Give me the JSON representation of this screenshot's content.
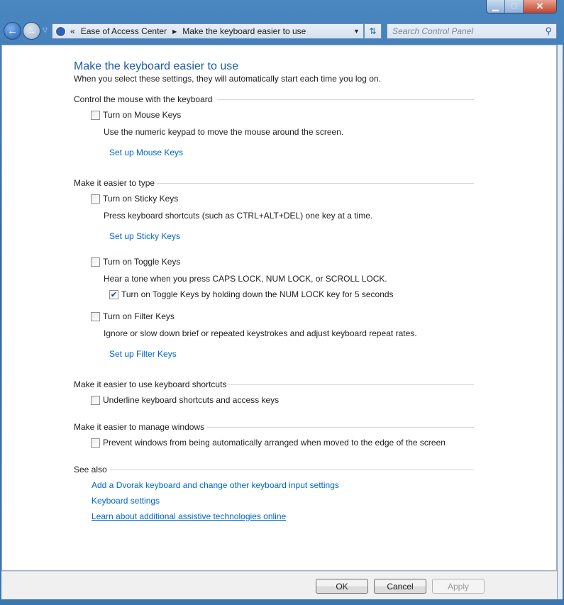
{
  "window": {
    "minimize_icon": "minimize-icon",
    "maximize_icon": "maximize-icon",
    "close_icon": "close-icon"
  },
  "address": {
    "chevrons": "«",
    "crumbs": [
      "Ease of Access Center",
      "Make the keyboard easier to use"
    ],
    "search_placeholder": "Search Control Panel"
  },
  "page": {
    "title": "Make the keyboard easier to use",
    "subtitle": "When you select these settings, they will automatically start each time you log on."
  },
  "sections": {
    "mouse": {
      "header": "Control the mouse with the keyboard",
      "checkbox": "Turn on Mouse Keys",
      "checked": false,
      "desc": "Use the numeric keypad to move the mouse around the screen.",
      "link": "Set up Mouse Keys"
    },
    "type": {
      "header": "Make it easier to type",
      "sticky": {
        "checkbox": "Turn on Sticky Keys",
        "checked": false,
        "desc": "Press keyboard shortcuts (such as CTRL+ALT+DEL) one key at a time.",
        "link": "Set up Sticky Keys"
      },
      "toggle": {
        "checkbox": "Turn on Toggle Keys",
        "checked": false,
        "desc": "Hear a tone when you press CAPS LOCK, NUM LOCK, or SCROLL LOCK.",
        "sub_checkbox": "Turn on Toggle Keys by holding down the NUM LOCK key for 5 seconds",
        "sub_checked": true
      },
      "filter": {
        "checkbox": "Turn on Filter Keys",
        "checked": false,
        "desc": "Ignore or slow down brief or repeated keystrokes and adjust keyboard repeat rates.",
        "link": "Set up Filter Keys"
      }
    },
    "shortcuts": {
      "header": "Make it easier to use keyboard shortcuts",
      "checkbox": "Underline keyboard shortcuts and access keys",
      "checked": false
    },
    "windows": {
      "header": "Make it easier to manage windows",
      "checkbox": "Prevent windows from being automatically arranged when moved to the edge of the screen",
      "checked": false
    },
    "see_also": {
      "header": "See also",
      "links": [
        "Add a Dvorak keyboard and change other keyboard input settings",
        "Keyboard settings",
        "Learn about additional assistive technologies online"
      ]
    }
  },
  "buttons": {
    "ok": "OK",
    "cancel": "Cancel",
    "apply": "Apply"
  }
}
